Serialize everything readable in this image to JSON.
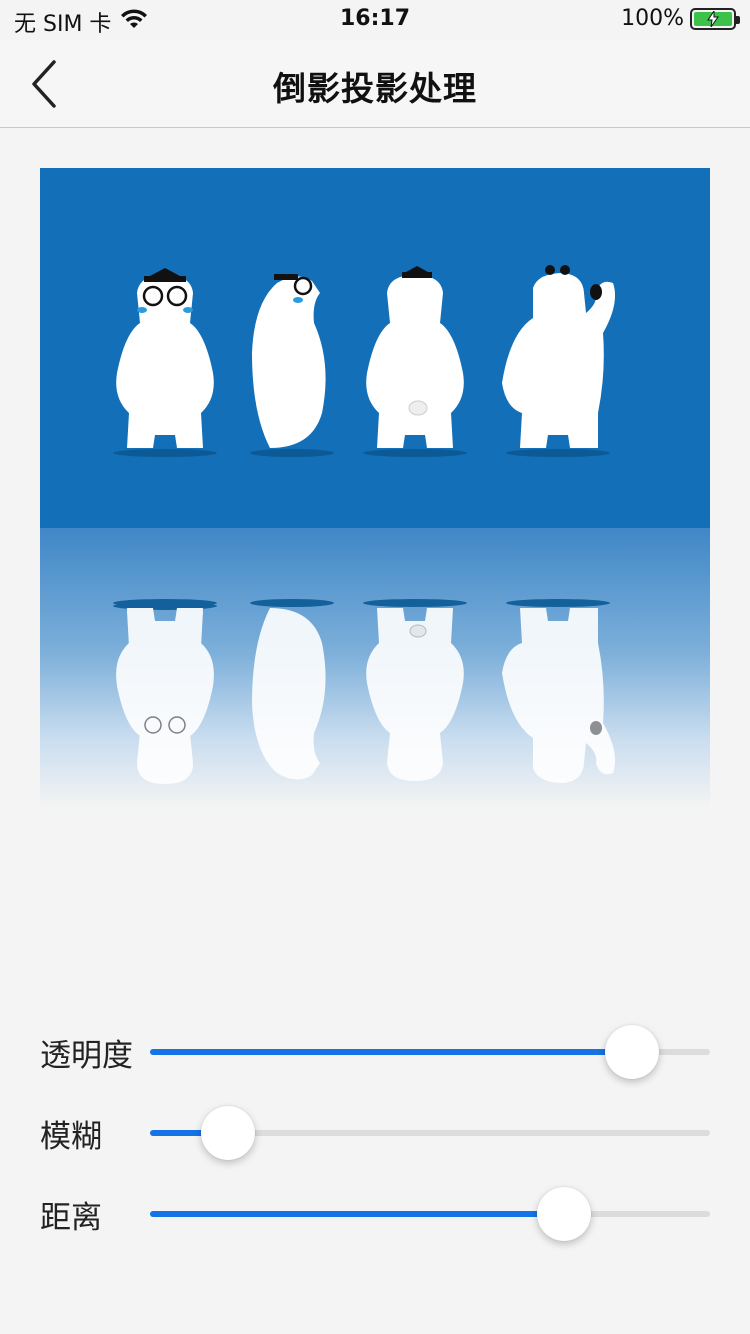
{
  "status_bar": {
    "carrier": "无 SIM 卡",
    "time": "16:17",
    "battery": "100%",
    "icons": [
      "wifi-icon",
      "battery-charging-icon"
    ]
  },
  "nav": {
    "back_icon": "chevron-left-icon",
    "title": "倒影投影处理"
  },
  "preview": {
    "background_color": "#1370b8",
    "figures": [
      "polar-bear-front-glasses",
      "polar-bear-side",
      "polar-bear-back",
      "polar-bear-waving"
    ]
  },
  "sliders": [
    {
      "label": "透明度",
      "value": 0.86
    },
    {
      "label": "模糊",
      "value": 0.14
    },
    {
      "label": "距离",
      "value": 0.74
    }
  ],
  "colors": {
    "accent": "#1473e6",
    "track": "#dcdcdc",
    "background": "#f4f4f4"
  }
}
